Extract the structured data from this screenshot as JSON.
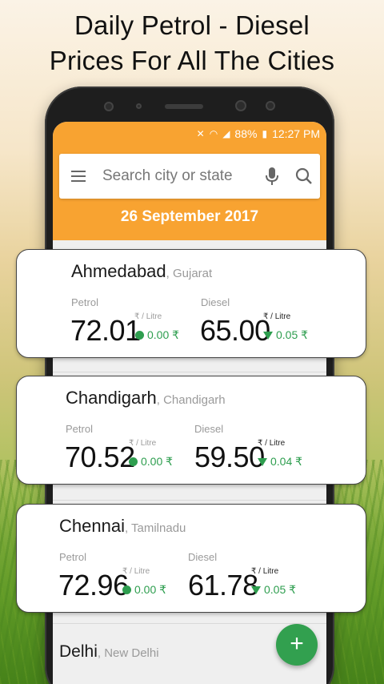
{
  "headline": [
    "Daily Petrol - Diesel",
    "Prices For All The Cities"
  ],
  "status": {
    "battery": "88%",
    "time": "12:27 PM"
  },
  "search": {
    "placeholder": "Search city or state"
  },
  "date": "26 September 2017",
  "unit_label": "₹ / Litre",
  "labels": {
    "petrol": "Petrol",
    "diesel": "Diesel"
  },
  "cities": [
    {
      "city": "Ahmedabad",
      "state": ", Gujarat",
      "petrol": {
        "price": "72.01",
        "change": "0.00 ₹",
        "trend": "flat"
      },
      "diesel": {
        "price": "65.00",
        "change": "0.05 ₹",
        "trend": "down"
      }
    },
    {
      "city": "Chandigarh",
      "state": ", Chandigarh",
      "petrol": {
        "price": "70.52",
        "change": "0.00 ₹",
        "trend": "flat"
      },
      "diesel": {
        "price": "59.50",
        "change": "0.04 ₹",
        "trend": "down"
      }
    },
    {
      "city": "Chennai",
      "state": ", Tamilnadu",
      "petrol": {
        "price": "72.96",
        "change": "0.00 ₹",
        "trend": "flat"
      },
      "diesel": {
        "price": "61.78",
        "change": "0.05 ₹",
        "trend": "down"
      }
    },
    {
      "city": "Delhi",
      "state": ", New Delhi"
    }
  ],
  "fab": "+",
  "colors": {
    "accent": "#f8a331",
    "up_down": "#2e9e4f"
  }
}
